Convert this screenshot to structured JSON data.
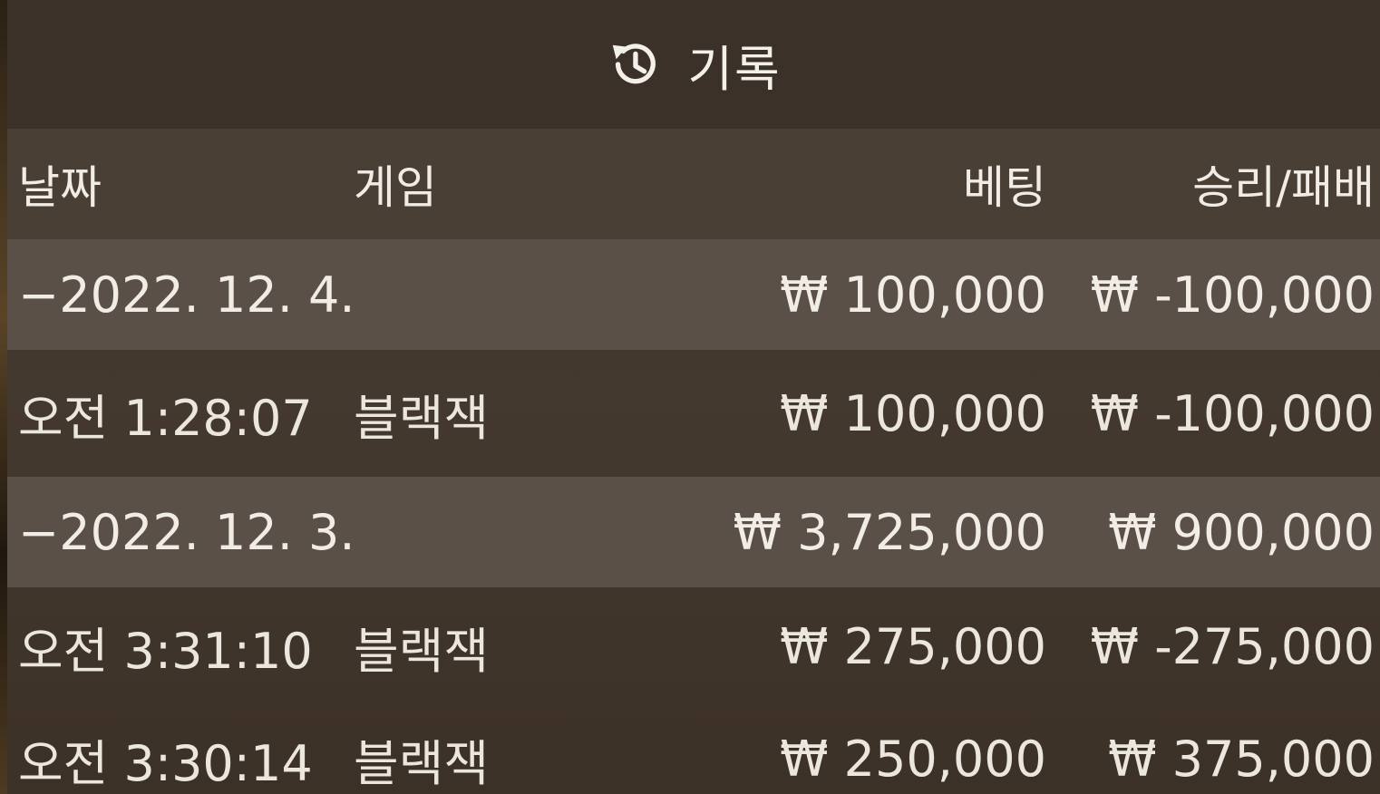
{
  "title": {
    "icon": "history-icon",
    "label": "기록"
  },
  "columns": {
    "date": "날짜",
    "game": "게임",
    "bet": "베팅",
    "win_loss": "승리/패배"
  },
  "rows": [
    {
      "type": "group",
      "date": "−2022. 12. 4.",
      "game": "",
      "bet": "₩ 100,000",
      "win_loss": "₩ -100,000"
    },
    {
      "type": "entry",
      "date": "오전 1:28:07",
      "game": "블랙잭",
      "bet": "₩ 100,000",
      "win_loss": "₩ -100,000"
    },
    {
      "type": "group",
      "date": "−2022. 12. 3.",
      "game": "",
      "bet": "₩ 3,725,000",
      "win_loss": "₩ 900,000"
    },
    {
      "type": "entry",
      "date": "오전 3:31:10",
      "game": "블랙잭",
      "bet": "₩ 275,000",
      "win_loss": "₩ -275,000"
    },
    {
      "type": "entry",
      "date": "오전 3:30:14",
      "game": "블랙잭",
      "bet": "₩ 250,000",
      "win_loss": "₩ 375,000"
    }
  ],
  "colors": {
    "panel": "#3e342a",
    "header_row": "#4a3f34",
    "group_row": "#5a5048",
    "text": "#f1ede6"
  }
}
